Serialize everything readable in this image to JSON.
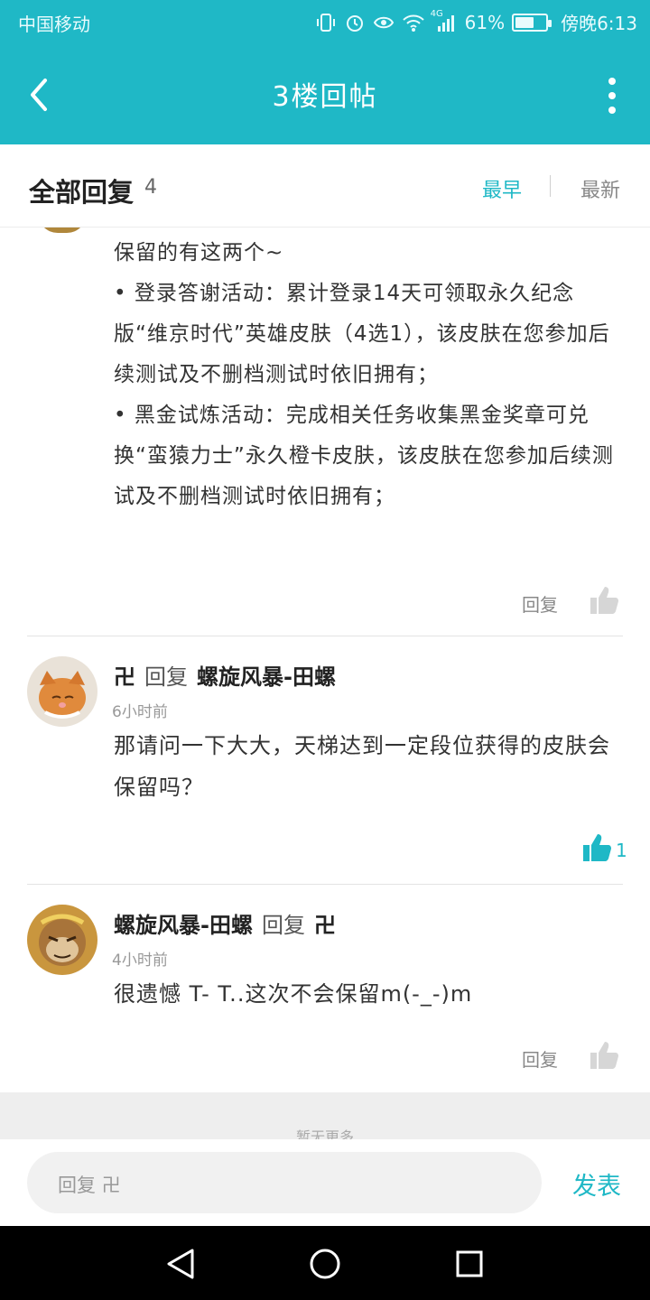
{
  "status_bar": {
    "carrier": "中国移动",
    "network": "4G",
    "battery_pct": "61%",
    "battery_level": 0.61,
    "time": "傍晚6:13"
  },
  "header": {
    "title": "3楼回帖",
    "back_icon": "chevron-left-icon",
    "more_icon": "more-vertical-icon"
  },
  "filter": {
    "label": "全部回复",
    "count": "4",
    "tab_earliest": "最早",
    "tab_latest": "最新"
  },
  "replies": [
    {
      "paragraphs": [
        "保留的有这两个~",
        "• 登录答谢活动：累计登录14天可领取永久纪念版“维京时代”英雄皮肤（4选1），该皮肤在您参加后续测试及不删档测试时依旧拥有；",
        "• 黑金试炼活动：完成相关任务收集黑金奖章可兑换“蛮猿力士”永久橙卡皮肤，该皮肤在您参加后续测试及不删档测试时依旧拥有；"
      ],
      "reply_label": "回复"
    },
    {
      "author": "卍",
      "verb": "回复",
      "target": "螺旋风暴-田螺",
      "time": "6小时前",
      "body": "那请问一下大大，天梯达到一定段位获得的皮肤会保留吗？",
      "likes": "1"
    },
    {
      "author": "螺旋风暴-田螺",
      "verb": "回复",
      "target": "卍",
      "time": "4小时前",
      "body": "很遗憾 T- T..这次不会保留m(-_-)m",
      "reply_label": "回复"
    }
  ],
  "band_hint": "暂无更多",
  "composer": {
    "placeholder": "回复 卍",
    "send_label": "发表"
  },
  "colors": {
    "accent": "#1fb8c6",
    "text": "#333333",
    "muted": "#999999"
  }
}
